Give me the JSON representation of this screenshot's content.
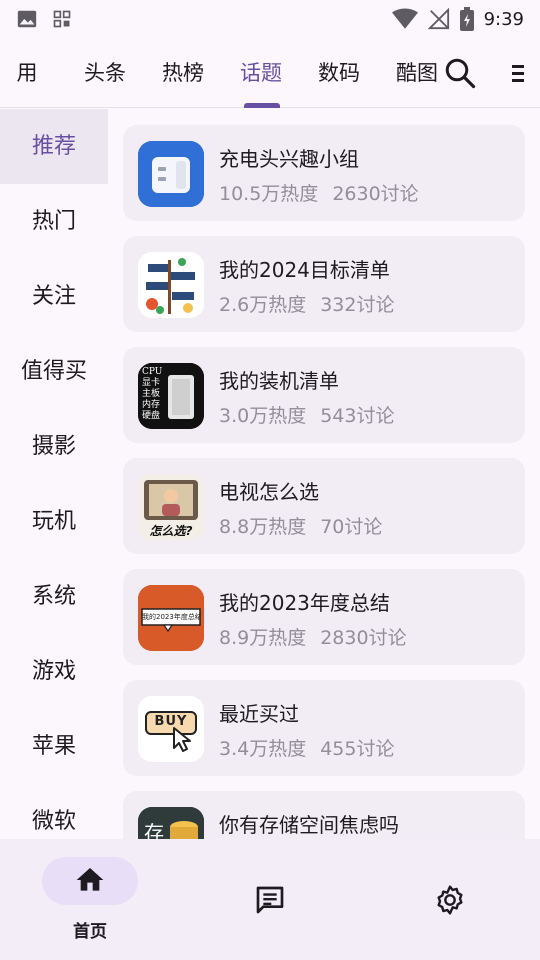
{
  "status_bar": {
    "time": "9:39"
  },
  "top_tabs": [
    {
      "label": "用",
      "active": false
    },
    {
      "label": "头条",
      "active": false
    },
    {
      "label": "热榜",
      "active": false
    },
    {
      "label": "话题",
      "active": true
    },
    {
      "label": "数码",
      "active": false
    },
    {
      "label": "酷图",
      "active": false
    }
  ],
  "sidebar": {
    "items": [
      {
        "label": "推荐",
        "active": true
      },
      {
        "label": "热门"
      },
      {
        "label": "关注"
      },
      {
        "label": "值得买"
      },
      {
        "label": "摄影"
      },
      {
        "label": "玩机"
      },
      {
        "label": "系统"
      },
      {
        "label": "游戏"
      },
      {
        "label": "苹果"
      },
      {
        "label": "微软"
      }
    ]
  },
  "topics": [
    {
      "title": "充电头兴趣小组",
      "heat": "10.5万热度",
      "discussions": "2630讨论",
      "thumb_text": ""
    },
    {
      "title": "我的2024目标清单",
      "heat": "2.6万热度",
      "discussions": "332讨论",
      "thumb_text": ""
    },
    {
      "title": "我的装机清单",
      "heat": "3.0万热度",
      "discussions": "543讨论",
      "thumb_text": "CPU 显卡 主板 内存 硬盘"
    },
    {
      "title": "电视怎么选",
      "heat": "8.8万热度",
      "discussions": "70讨论",
      "thumb_text": "怎么选?"
    },
    {
      "title": "我的2023年度总结",
      "heat": "8.9万热度",
      "discussions": "2830讨论",
      "thumb_text": "我的2023年度总结"
    },
    {
      "title": "最近买过",
      "heat": "3.4万热度",
      "discussions": "455讨论",
      "thumb_text": "BUY"
    },
    {
      "title": "你有存储空间焦虑吗",
      "heat": "",
      "discussions": "",
      "thumb_text": "存"
    }
  ],
  "bottom_nav": {
    "home_label": "首页"
  },
  "colors": {
    "accent": "#6750a4",
    "pill": "#e8def8"
  }
}
